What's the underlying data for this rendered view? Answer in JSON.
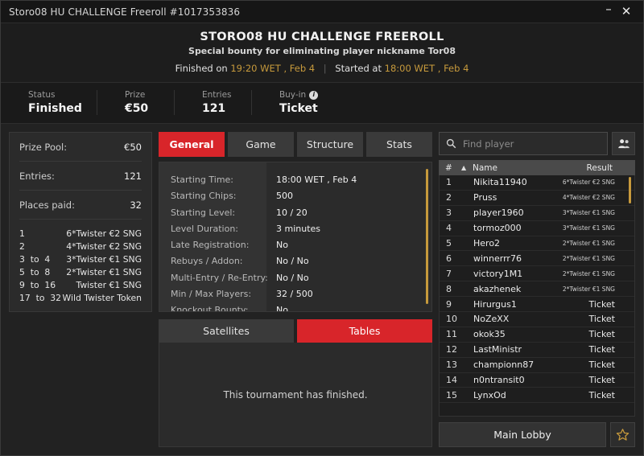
{
  "window": {
    "title": "Storo08 HU CHALLENGE Freeroll #1017353836",
    "minimize_label": "–",
    "close_label": "✕"
  },
  "header": {
    "title": "STORO08 HU CHALLENGE FREEROLL",
    "subtitle": "Special bounty for eliminating player nickname Tor08",
    "finished_prefix": "Finished on",
    "finished_time": "19:20 WET , Feb 4",
    "separator": "|",
    "started_prefix": "Started at",
    "started_time": "18:00 WET , Feb 4"
  },
  "stats": [
    {
      "label": "Status",
      "value": "Finished",
      "info": false
    },
    {
      "label": "Prize",
      "value": "€50",
      "info": false
    },
    {
      "label": "Entries",
      "value": "121",
      "info": false
    },
    {
      "label": "Buy-in",
      "value": "Ticket",
      "info": true,
      "info_glyph": "i"
    }
  ],
  "prize_panel": {
    "rows": [
      {
        "label": "Prize Pool:",
        "value": "€50"
      },
      {
        "label": "Entries:",
        "value": "121"
      },
      {
        "label": "Places paid:",
        "value": "32"
      }
    ],
    "payouts": [
      {
        "rank": "1",
        "prize": "6*Twister €2 SNG"
      },
      {
        "rank": "2",
        "prize": "4*Twister €2 SNG"
      },
      {
        "rank": "3  to  4",
        "prize": "3*Twister €1 SNG"
      },
      {
        "rank": "5  to  8",
        "prize": "2*Twister €1 SNG"
      },
      {
        "rank": "9  to  16",
        "prize": "Twister €1 SNG"
      },
      {
        "rank": "17  to  32",
        "prize": "Wild Twister Token"
      }
    ]
  },
  "tabs": [
    {
      "label": "General",
      "active": true
    },
    {
      "label": "Game",
      "active": false
    },
    {
      "label": "Structure",
      "active": false
    },
    {
      "label": "Stats",
      "active": false
    }
  ],
  "general": {
    "rows": [
      {
        "label": "Starting Time:",
        "value": "18:00 WET , Feb 4"
      },
      {
        "label": "Starting Chips:",
        "value": "500"
      },
      {
        "label": "Starting Level:",
        "value": "10 / 20"
      },
      {
        "label": "Level Duration:",
        "value": "3 minutes"
      },
      {
        "label": "Late Registration:",
        "value": "No"
      },
      {
        "label": "Rebuys / Addon:",
        "value": "No / No"
      },
      {
        "label": "Multi-Entry / Re-Entry:",
        "value": "No / No"
      },
      {
        "label": "Min / Max Players:",
        "value": "32 / 500"
      },
      {
        "label": "Knockout Bounty:",
        "value": "No"
      }
    ]
  },
  "sub_tabs": [
    {
      "label": "Satellites",
      "active": false
    },
    {
      "label": "Tables",
      "active": true
    }
  ],
  "finished_message": "This tournament has finished.",
  "search": {
    "placeholder": "Find player",
    "value": "",
    "icon": "search-icon",
    "people_icon": "people-icon"
  },
  "player_list": {
    "columns": {
      "num": "#",
      "sort_arrow": "▲",
      "name": "Name",
      "result": "Result"
    },
    "rows": [
      {
        "n": "1",
        "name": "Nikita11940",
        "result": "6*Twister €2 SNG",
        "small": true
      },
      {
        "n": "2",
        "name": "Pruss",
        "result": "4*Twister €2 SNG",
        "small": true
      },
      {
        "n": "3",
        "name": "player1960",
        "result": "3*Twister €1 SNG",
        "small": true
      },
      {
        "n": "4",
        "name": "tormoz000",
        "result": "3*Twister €1 SNG",
        "small": true
      },
      {
        "n": "5",
        "name": "Hero2",
        "result": "2*Twister €1 SNG",
        "small": true
      },
      {
        "n": "6",
        "name": "winnerrr76",
        "result": "2*Twister €1 SNG",
        "small": true
      },
      {
        "n": "7",
        "name": "victory1M1",
        "result": "2*Twister €1 SNG",
        "small": true
      },
      {
        "n": "8",
        "name": "akazhenek",
        "result": "2*Twister €1 SNG",
        "small": true
      },
      {
        "n": "9",
        "name": "Hirurgus1",
        "result": "Ticket",
        "small": false
      },
      {
        "n": "10",
        "name": "NoZeXX",
        "result": "Ticket",
        "small": false
      },
      {
        "n": "11",
        "name": "okok35",
        "result": "Ticket",
        "small": false
      },
      {
        "n": "12",
        "name": "LastMinistr",
        "result": "Ticket",
        "small": false
      },
      {
        "n": "13",
        "name": "championn87",
        "result": "Ticket",
        "small": false
      },
      {
        "n": "14",
        "name": "n0ntransit0",
        "result": "Ticket",
        "small": false
      },
      {
        "n": "15",
        "name": "LynxOd",
        "result": "Ticket",
        "small": false
      }
    ]
  },
  "footer": {
    "main_lobby_label": "Main Lobby",
    "star_icon": "star-icon"
  },
  "colors": {
    "accent_red": "#d8252a",
    "accent_gold": "#c79a3c",
    "panel_bg": "#2b2b2b",
    "window_bg": "#232323"
  }
}
